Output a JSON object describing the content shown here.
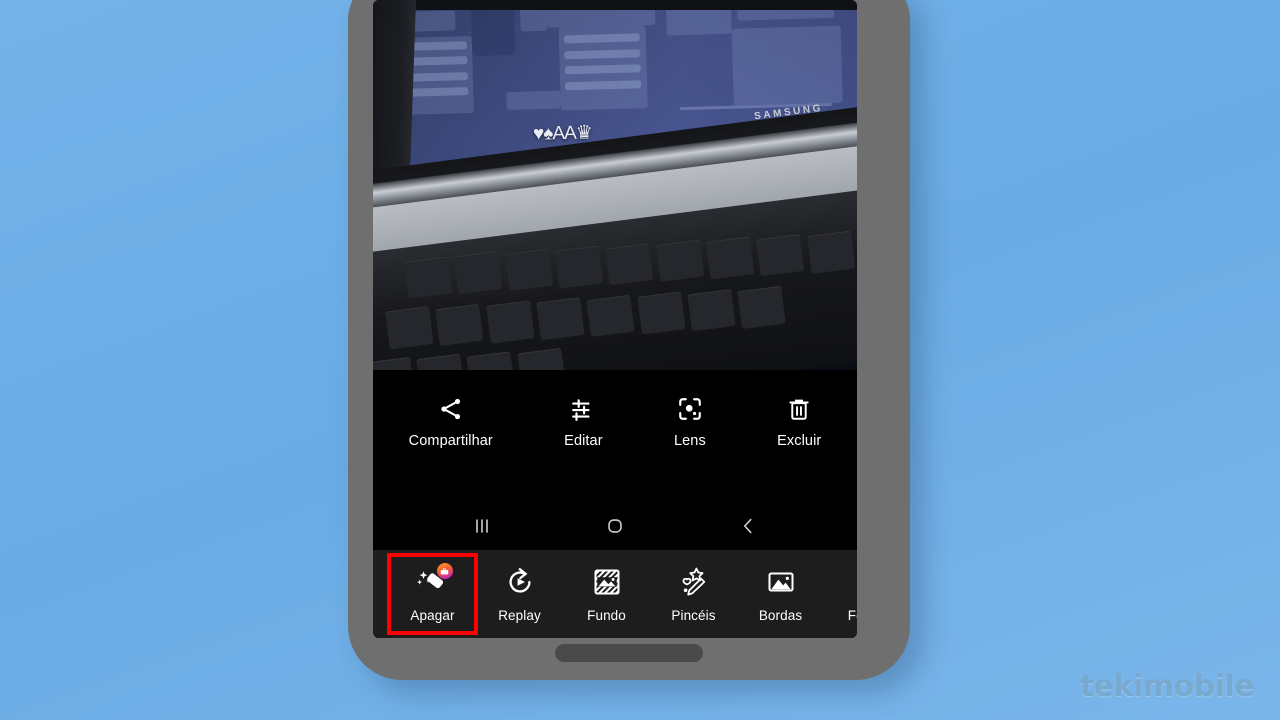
{
  "background": {
    "color": "#6eaee6"
  },
  "watermark": {
    "text": "tekimobile",
    "color": "#7aa9cf"
  },
  "phone": {
    "body_color": "#6f6f6f",
    "screen_color": "#000000",
    "home_indicator": "home-indicator-pill"
  },
  "photo_preview": {
    "description_alt": "Foto de um notebook Samsung aberto mostrando um jogo na tela",
    "device_brand_text": "SAMSUNG",
    "game_hud_text": "♥♠AA♛",
    "screen_tint": "#4a5892"
  },
  "actions": {
    "items": [
      {
        "label": "Compartilhar",
        "icon": "share-icon"
      },
      {
        "label": "Editar",
        "icon": "sliders-icon"
      },
      {
        "label": "Lens",
        "icon": "lens-icon"
      },
      {
        "label": "Excluir",
        "icon": "trash-icon"
      }
    ]
  },
  "navbar": {
    "items": [
      {
        "label": "Recentes",
        "icon": "recents-icon"
      },
      {
        "label": "Início",
        "icon": "home-icon"
      },
      {
        "label": "Voltar",
        "icon": "back-icon"
      }
    ]
  },
  "toolstrip": {
    "highlight_color": "#ff0000",
    "selected_index": 0,
    "items": [
      {
        "label": "Apagar",
        "icon": "magic-eraser-icon",
        "badge": "toolbox-badge-icon",
        "selected": true
      },
      {
        "label": "Replay",
        "icon": "replay-icon",
        "badge": null,
        "selected": false
      },
      {
        "label": "Fundo",
        "icon": "background-icon",
        "badge": null,
        "selected": false
      },
      {
        "label": "Pincéis",
        "icon": "brushes-icon",
        "badge": null,
        "selected": false
      },
      {
        "label": "Bordas",
        "icon": "borders-icon",
        "badge": null,
        "selected": false
      },
      {
        "label": "Forma",
        "icon": "shape-icon",
        "badge": null,
        "selected": false
      }
    ]
  }
}
